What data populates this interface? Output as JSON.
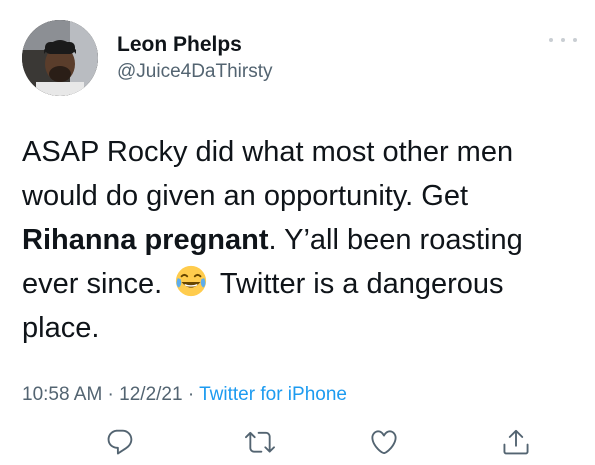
{
  "tweet": {
    "author": {
      "display_name": "Leon Phelps",
      "handle": "@Juice4DaThirsty"
    },
    "text": {
      "part1": "ASAP Rocky did what most other men would do given an opportunity. Get ",
      "bold": "Rihanna pregnant",
      "part2": ". Y’all been roasting ever since.",
      "part3": "Twitter is a dangerous place."
    },
    "emoji": "face-with-tears-of-joy",
    "meta": {
      "time": "10:58 AM",
      "sep1": " · ",
      "date": "12/2/21",
      "sep2": " · ",
      "source": "Twitter for iPhone"
    }
  },
  "icons": {
    "more": "more-horizontal-icon",
    "reply": "reply-icon",
    "retweet": "retweet-icon",
    "like": "heart-icon",
    "share": "share-icon"
  },
  "colors": {
    "text": "#0f1419",
    "secondary": "#536471",
    "link": "#1d9bf0"
  }
}
